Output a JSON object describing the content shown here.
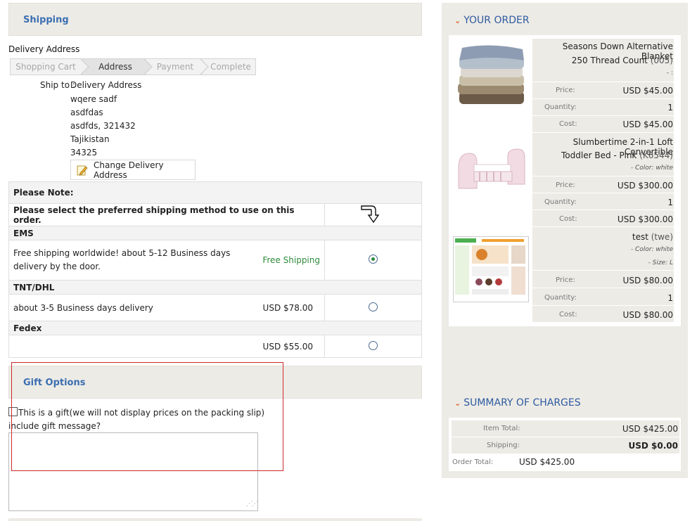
{
  "shipping_header": "Shipping",
  "delivery_address_label": "Delivery Address",
  "steps": [
    "Shopping Cart",
    "Address",
    "Payment",
    "Complete"
  ],
  "ship_to_label": "Ship to :",
  "address_lines": [
    "Delivery Address",
    "wqere sadf",
    "asdfdas",
    "asdfds, 321432",
    "Tajikistan",
    "34325"
  ],
  "change_address_button": "Change Delivery Address",
  "shipping_table": {
    "please_note": "Please Note:",
    "instruction": "Please select the preferred shipping method to use on this order.",
    "methods": [
      {
        "name": "EMS",
        "description": "Free shipping worldwide! about 5-12 Business days delivery by the door.",
        "price": "Free Shipping",
        "selected": true
      },
      {
        "name": "TNT/DHL",
        "description": "about 3-5 Business days delivery",
        "price": "USD $78.00",
        "selected": false
      },
      {
        "name": "Fedex",
        "description": "",
        "price": "USD $55.00",
        "selected": false
      }
    ]
  },
  "gift": {
    "header": "Gift Options",
    "checkbox_label": "This is a gift(we will not display prices on the packing slip)",
    "message_label": "include gift message?",
    "message_value": ""
  },
  "order": {
    "title": "YOUR ORDER",
    "items": [
      {
        "name_line1": "Seasons Down Alternative Blanket",
        "name_line2": "250 Thread Count",
        "code": "(005)",
        "attr_line": "- :",
        "price": "USD $45.00",
        "quantity": "1",
        "cost": "USD $45.00"
      },
      {
        "name_line1": "Slumbertime 2-in-1 Loft Convertible",
        "name_line2": "Toddler Bed - Pink",
        "code": "(K6544)",
        "attr_line": "- Color: white",
        "price": "USD $300.00",
        "quantity": "1",
        "cost": "USD $300.00"
      },
      {
        "name_line1": "",
        "name_line2": "test",
        "code": "(twe)",
        "attr_line": "- Color: white",
        "attr_line2": "- Size: L",
        "price": "USD $80.00",
        "quantity": "1",
        "cost": "USD $80.00"
      }
    ],
    "labels": {
      "price": "Price:",
      "quantity": "Quantity:",
      "cost": "Cost:"
    }
  },
  "summary": {
    "title": "SUMMARY OF CHARGES",
    "item_total_label": "Item Total:",
    "item_total": "USD $425.00",
    "shipping_label": "Shipping:",
    "shipping": "USD $0.00",
    "order_total_label": "Order Total:",
    "order_total": "USD $425.00"
  }
}
